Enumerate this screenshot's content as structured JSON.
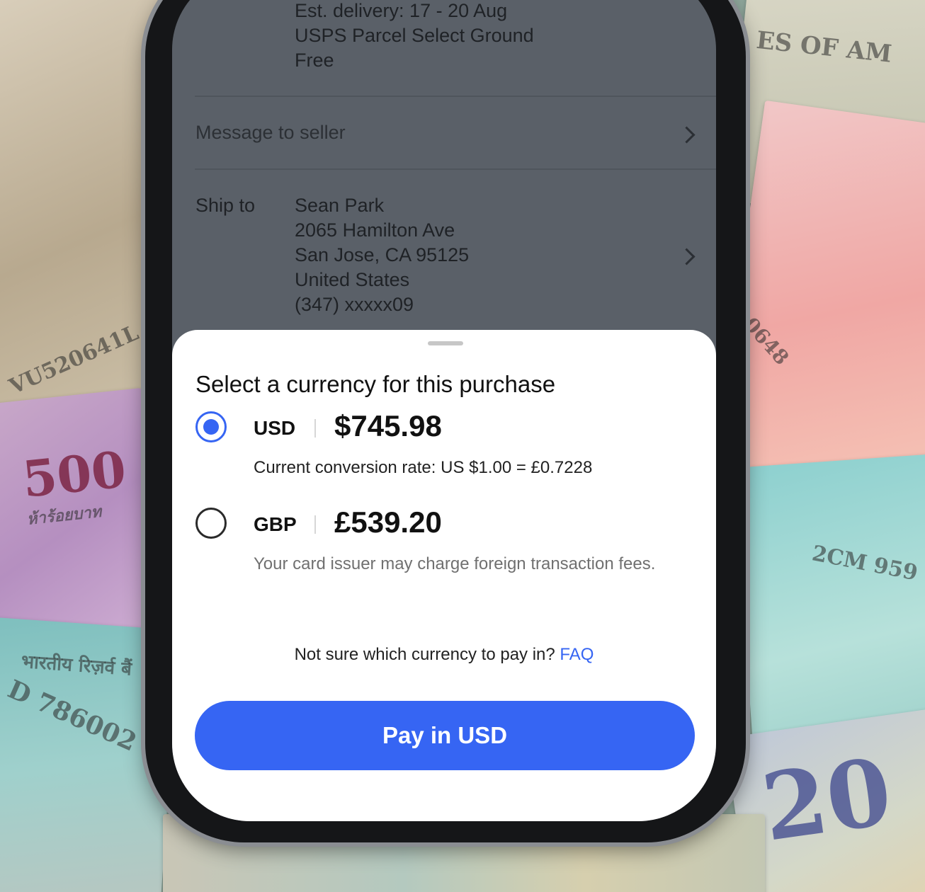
{
  "background": {
    "notes": [
      {
        "id": "yen",
        "text": "VU520641L"
      },
      {
        "id": "thb",
        "text": "500",
        "subtext": "ห้าร้อยบาท"
      },
      {
        "id": "inr-l",
        "text": "D 786002",
        "subtext": "भारतीय रिज़र्व बैं"
      },
      {
        "id": "usd",
        "text": "ES OF AM"
      },
      {
        "id": "cny",
        "text": "0648"
      },
      {
        "id": "inr-r",
        "text": "2CM 959"
      },
      {
        "id": "eur",
        "text": "20"
      }
    ]
  },
  "underlying_page": {
    "delivery": {
      "estimate": "Est. delivery: 17 - 20 Aug",
      "service": "USPS Parcel Select Ground",
      "price": "Free"
    },
    "message_to_seller": "Message to seller",
    "ship_to": {
      "label": "Ship to",
      "name": "Sean Park",
      "street": "2065 Hamilton Ave",
      "city": "San Jose, CA 95125",
      "country": "United States",
      "phone": "(347) xxxxx09"
    }
  },
  "sheet": {
    "title": "Select a currency for this purchase",
    "options": [
      {
        "code": "USD",
        "amount": "$745.98",
        "note": "Current conversion rate: US $1.00 = £0.7228",
        "selected": true
      },
      {
        "code": "GBP",
        "amount": "£539.20",
        "note": "Your card issuer may charge foreign transaction fees.",
        "selected": false
      }
    ],
    "help_text": "Not sure which currency to pay in?",
    "help_link": "FAQ",
    "pay_button": "Pay in USD"
  },
  "colors": {
    "accent": "#3665f3",
    "dim_overlay": "#5a6068"
  }
}
